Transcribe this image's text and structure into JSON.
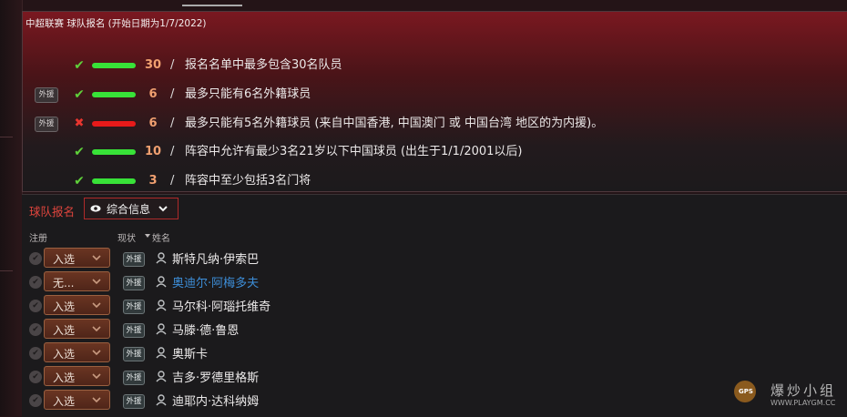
{
  "rules_panel": {
    "title": "中超联赛 球队报名 (开始日期为1/7/2022)",
    "rules": [
      {
        "tag": "",
        "status": "ok",
        "count": "30",
        "text": "报名名单中最多包含30名队员"
      },
      {
        "tag": "外援",
        "status": "ok",
        "count": "6",
        "text": "最多只能有6名外籍球员"
      },
      {
        "tag": "外援",
        "status": "fail",
        "count": "6",
        "text": "最多只能有5名外籍球员 (来自中国香港, 中国澳门 或 中国台湾 地区的为内援)。"
      },
      {
        "tag": "",
        "status": "ok",
        "count": "10",
        "text": "阵容中允许有最少3名21岁以下中国球员 (出生于1/1/2001以后)"
      },
      {
        "tag": "",
        "status": "ok",
        "count": "3",
        "text": "阵容中至少包括3名门将"
      }
    ],
    "slash": "/",
    "colors": {
      "ok": "#38e238",
      "fail": "#e81a1a",
      "count": "#f0a070"
    }
  },
  "roster": {
    "label": "球队报名",
    "view_dropdown": {
      "value": "综合信息",
      "icon": "eye-icon"
    },
    "columns": {
      "register": "注册",
      "status": "现状",
      "name": "姓名"
    },
    "players": [
      {
        "status": "入选",
        "tag": "外援",
        "name": "斯特凡纳·伊索巴",
        "selected": false
      },
      {
        "status": "无...",
        "tag": "外援",
        "name": "奥迪尔·阿梅多夫",
        "selected": true
      },
      {
        "status": "入选",
        "tag": "外援",
        "name": "马尔科·阿瑙托维奇",
        "selected": false
      },
      {
        "status": "入选",
        "tag": "外援",
        "name": "马滕·德·鲁恩",
        "selected": false
      },
      {
        "status": "入选",
        "tag": "外援",
        "name": "奥斯卡",
        "selected": false
      },
      {
        "status": "入选",
        "tag": "外援",
        "name": "吉多·罗德里格斯",
        "selected": false
      },
      {
        "status": "入选",
        "tag": "外援",
        "name": "迪耶内·达科纳姆",
        "selected": false
      }
    ],
    "colors": {
      "accent": "#e0453d",
      "selected_name": "#3d8ed8"
    }
  },
  "watermark": {
    "cn": "爆炒小组",
    "url": "WWW.PLAYGM.CC",
    "badge": "GPS"
  }
}
